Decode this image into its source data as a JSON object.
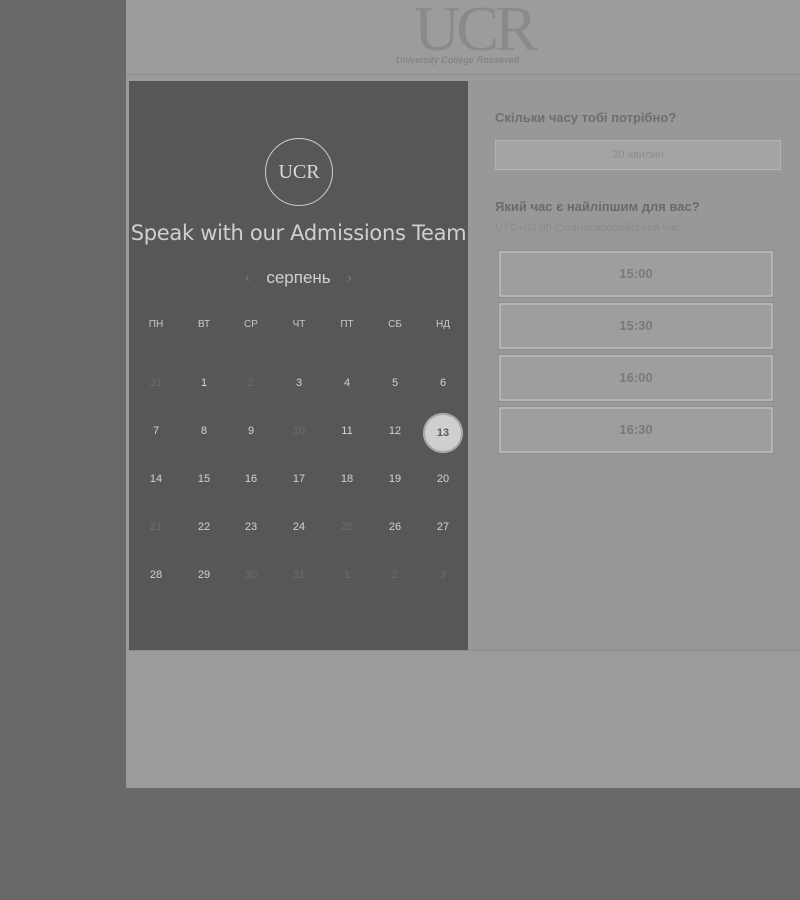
{
  "header": {
    "logo_text": "UCR",
    "logo_subtext": "University College Roosevelt"
  },
  "calendar": {
    "badge": "UCR",
    "title": "Speak with our Admissions Team",
    "month": "серпень",
    "prev_icon": "‹",
    "next_icon": "›",
    "weekdays": [
      "ПН",
      "ВТ",
      "СР",
      "ЧТ",
      "ПТ",
      "СБ",
      "НД"
    ],
    "weeks": [
      [
        {
          "d": "31",
          "muted": true
        },
        {
          "d": "1"
        },
        {
          "d": "2",
          "muted": true
        },
        {
          "d": "3"
        },
        {
          "d": "4"
        },
        {
          "d": "5"
        },
        {
          "d": "6"
        }
      ],
      [
        {
          "d": "7"
        },
        {
          "d": "8"
        },
        {
          "d": "9"
        },
        {
          "d": "10",
          "muted": true
        },
        {
          "d": "11"
        },
        {
          "d": "12"
        },
        {
          "d": "13",
          "selected": true
        }
      ],
      [
        {
          "d": "14"
        },
        {
          "d": "15"
        },
        {
          "d": "16"
        },
        {
          "d": "17"
        },
        {
          "d": "18"
        },
        {
          "d": "19"
        },
        {
          "d": "20"
        }
      ],
      [
        {
          "d": "21",
          "muted": true
        },
        {
          "d": "22"
        },
        {
          "d": "23"
        },
        {
          "d": "24"
        },
        {
          "d": "25",
          "muted": true
        },
        {
          "d": "26"
        },
        {
          "d": "27"
        }
      ],
      [
        {
          "d": "28"
        },
        {
          "d": "29"
        },
        {
          "d": "30",
          "muted": true
        },
        {
          "d": "31",
          "muted": true
        },
        {
          "d": "1",
          "muted": true
        },
        {
          "d": "2",
          "muted": true
        },
        {
          "d": "3",
          "muted": true
        }
      ]
    ]
  },
  "booking": {
    "duration_question": "Скільки часу тобі потрібно?",
    "duration_value": "30 хвилин",
    "time_question": "Який час є найліпшим для вас?",
    "timezone": "UTC+03:00 Східноєвропейський час",
    "slots": [
      "15:00",
      "15:30",
      "16:00",
      "16:30"
    ]
  }
}
